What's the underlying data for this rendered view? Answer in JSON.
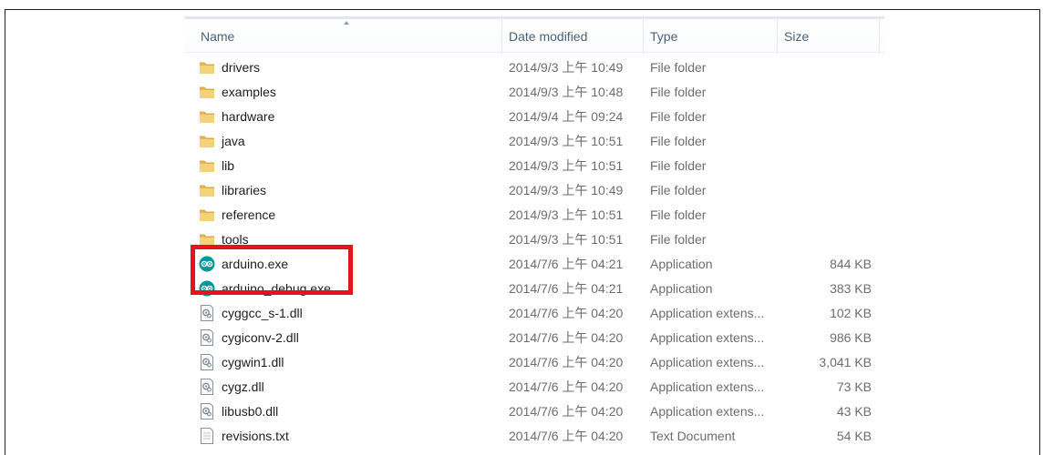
{
  "columns": {
    "name": "Name",
    "date": "Date modified",
    "type": "Type",
    "size": "Size"
  },
  "files": [
    {
      "name": "drivers",
      "date": "2014/9/3 上午 10:49",
      "type": "File folder",
      "size": "",
      "icon": "folder-icon"
    },
    {
      "name": "examples",
      "date": "2014/9/3 上午 10:48",
      "type": "File folder",
      "size": "",
      "icon": "folder-icon"
    },
    {
      "name": "hardware",
      "date": "2014/9/4 上午 09:24",
      "type": "File folder",
      "size": "",
      "icon": "folder-icon"
    },
    {
      "name": "java",
      "date": "2014/9/3 上午 10:51",
      "type": "File folder",
      "size": "",
      "icon": "folder-icon"
    },
    {
      "name": "lib",
      "date": "2014/9/3 上午 10:51",
      "type": "File folder",
      "size": "",
      "icon": "folder-icon"
    },
    {
      "name": "libraries",
      "date": "2014/9/3 上午 10:49",
      "type": "File folder",
      "size": "",
      "icon": "folder-icon"
    },
    {
      "name": "reference",
      "date": "2014/9/3 上午 10:51",
      "type": "File folder",
      "size": "",
      "icon": "folder-icon"
    },
    {
      "name": "tools",
      "date": "2014/9/3 上午 10:51",
      "type": "File folder",
      "size": "",
      "icon": "folder-icon"
    },
    {
      "name": "arduino.exe",
      "date": "2014/7/6 上午 04:21",
      "type": "Application",
      "size": "844 KB",
      "icon": "arduino-icon"
    },
    {
      "name": "arduino_debug.exe",
      "date": "2014/7/6 上午 04:21",
      "type": "Application",
      "size": "383 KB",
      "icon": "arduino-icon"
    },
    {
      "name": "cyggcc_s-1.dll",
      "date": "2014/7/6 上午 04:20",
      "type": "Application extens...",
      "size": "102 KB",
      "icon": "dll-icon"
    },
    {
      "name": "cygiconv-2.dll",
      "date": "2014/7/6 上午 04:20",
      "type": "Application extens...",
      "size": "986 KB",
      "icon": "dll-icon"
    },
    {
      "name": "cygwin1.dll",
      "date": "2014/7/6 上午 04:20",
      "type": "Application extens...",
      "size": "3,041 KB",
      "icon": "dll-icon"
    },
    {
      "name": "cygz.dll",
      "date": "2014/7/6 上午 04:20",
      "type": "Application extens...",
      "size": "73 KB",
      "icon": "dll-icon"
    },
    {
      "name": "libusb0.dll",
      "date": "2014/7/6 上午 04:20",
      "type": "Application extens...",
      "size": "43 KB",
      "icon": "dll-icon"
    },
    {
      "name": "revisions.txt",
      "date": "2014/7/6 上午 04:20",
      "type": "Text Document",
      "size": "54 KB",
      "icon": "text-file-icon"
    }
  ],
  "colors": {
    "header_text": "#4c607a",
    "highlight": "#e3141b",
    "folder": "#e8b94a",
    "arduino": "#00979c"
  }
}
